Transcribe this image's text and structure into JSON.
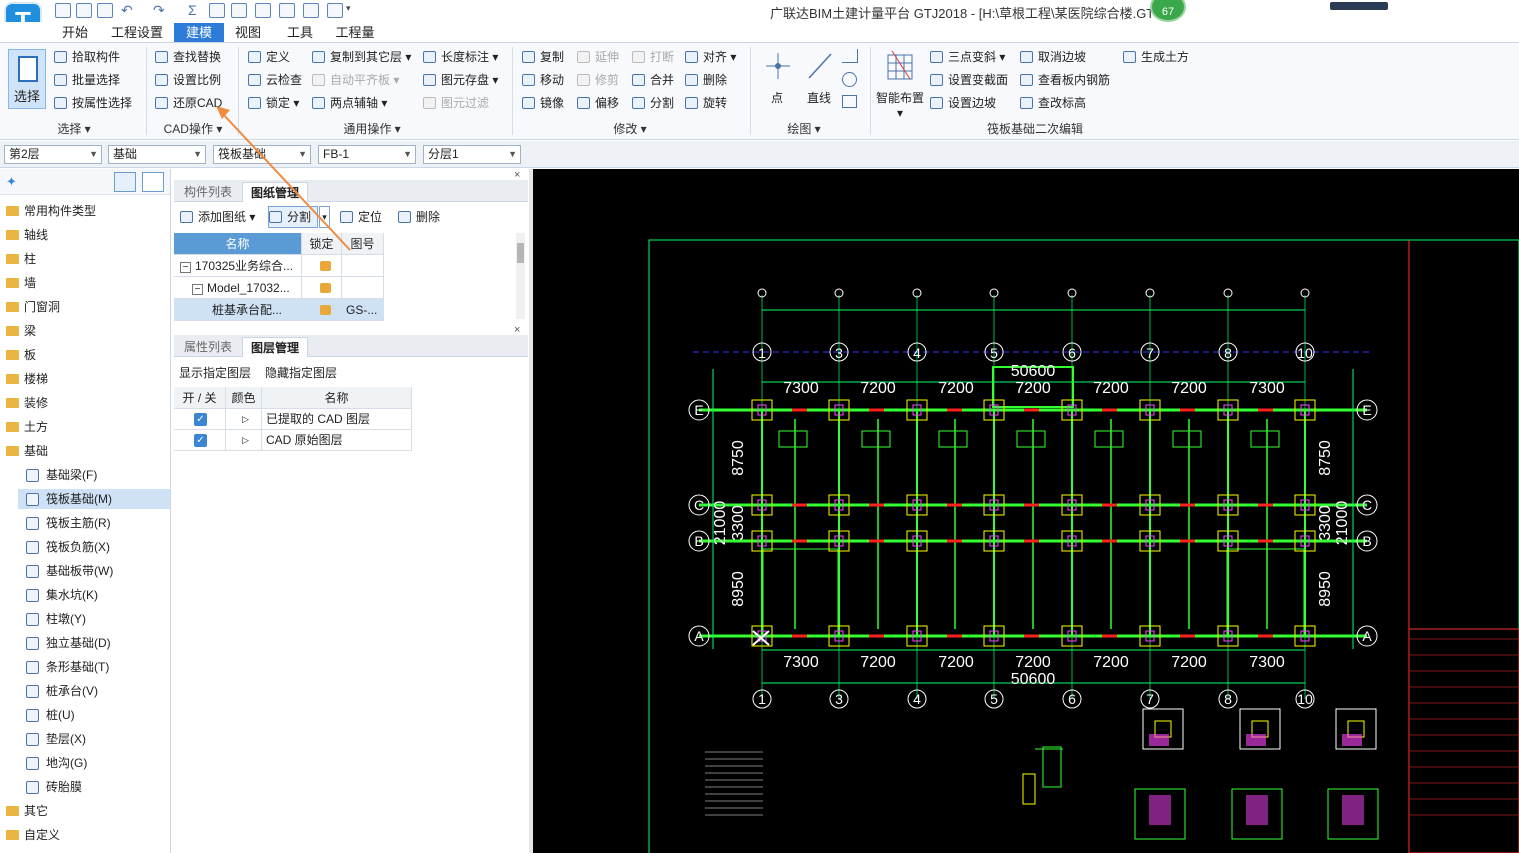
{
  "app": {
    "logo": "T",
    "title": "广联达BIM土建计量平台 GTJ2018 - [H:\\草根工程\\某医院综合楼.GTJ]",
    "badge": "67"
  },
  "quick_access_icons": [
    "save-icon",
    "new-icon",
    "open-icon",
    "undo-icon",
    "redo-icon",
    "sum-icon",
    "table-icon",
    "report-icon",
    "view-icon",
    "arrow-icon",
    "grid-icon",
    "layer-icon",
    "more-icon"
  ],
  "menu": {
    "tabs": [
      "开始",
      "工程设置",
      "建模",
      "视图",
      "工具",
      "工程量"
    ],
    "active": "建模"
  },
  "ribbon": {
    "select": {
      "big": "选择",
      "items": [
        "拾取构件",
        "批量选择",
        "按属性选择"
      ],
      "group": "选择"
    },
    "cad": {
      "items": [
        "查找替换",
        "设置比例",
        "还原CAD"
      ],
      "group": "CAD操作"
    },
    "common": {
      "col1": [
        "定义",
        "云检查",
        "锁定"
      ],
      "col2": [
        "复制到其它层",
        "自动平齐板",
        "两点辅轴"
      ],
      "col3": [
        "长度标注",
        "图元存盘",
        "图元过滤"
      ],
      "group": "通用操作"
    },
    "modify": {
      "col1": [
        "复制",
        "移动",
        "镜像"
      ],
      "col2": [
        "延伸",
        "修剪",
        "偏移"
      ],
      "col3": [
        "打断",
        "合并",
        "分割"
      ],
      "col4": [
        "对齐",
        "删除",
        "旋转"
      ],
      "group": "修改"
    },
    "draw": {
      "items": [
        "点",
        "直线"
      ],
      "group": "绘图"
    },
    "raft": {
      "big": "智能布置",
      "col1": [
        "三点变斜",
        "设置变截面",
        "设置边坡"
      ],
      "col2": [
        "取消边坡",
        "查看板内钢筋",
        "查改标高"
      ],
      "col3": [
        "生成土方"
      ],
      "group": "筏板基础二次编辑"
    }
  },
  "filters": [
    "第2层",
    "基础",
    "筏板基础",
    "FB-1",
    "分层1"
  ],
  "tree": {
    "categories": [
      "常用构件类型",
      "轴线",
      "柱",
      "墙",
      "门窗洞",
      "梁",
      "板",
      "楼梯",
      "装修",
      "土方",
      "基础"
    ],
    "sub_items": [
      "基础梁(F)",
      "筏板基础(M)",
      "筏板主筋(R)",
      "筏板负筋(X)",
      "基础板带(W)",
      "集水坑(K)",
      "柱墩(Y)",
      "独立基础(D)",
      "条形基础(T)",
      "桩承台(V)",
      "桩(U)",
      "垫层(X)",
      "地沟(G)",
      "砖胎膜"
    ],
    "selected": "筏板基础(M)",
    "tail": [
      "其它",
      "自定义"
    ]
  },
  "drawings": {
    "tabs": [
      "构件列表",
      "图纸管理"
    ],
    "toolbar": [
      "添加图纸",
      "分割",
      "定位",
      "删除"
    ],
    "headers": [
      "名称",
      "锁定",
      "图号"
    ],
    "rows": [
      {
        "name": "170325业务综合...",
        "lock": "",
        "code": ""
      },
      {
        "name": "Model_17032...",
        "lock": "",
        "code": ""
      },
      {
        "name": "桩基承台配...",
        "lock": "",
        "code": "GS-..."
      }
    ]
  },
  "layers": {
    "tabs": [
      "属性列表",
      "图层管理"
    ],
    "toolbar": [
      "显示指定图层",
      "隐藏指定图层"
    ],
    "headers": [
      "开 / 关",
      "颜色",
      "名称"
    ],
    "rows": [
      "已提取的 CAD 图层",
      "CAD 原始图层"
    ]
  },
  "cad_drawing": {
    "top_total": "50600",
    "bottom_total": "50600",
    "top_spans": [
      "7300",
      "7200",
      "7200",
      "7200",
      "7200",
      "7200",
      "7300"
    ],
    "bottom_spans": [
      "7300",
      "7200",
      "7200",
      "7200",
      "7200",
      "7200",
      "7300"
    ],
    "axis_numbers": [
      "1",
      "3",
      "4",
      "5",
      "6",
      "7",
      "8",
      "10"
    ],
    "row_axes": [
      "E",
      "C",
      "B",
      "A"
    ],
    "left_dims": [
      "8750",
      "21000",
      "3300",
      "8950"
    ],
    "right_dims": [
      "8750",
      "3300",
      "21000",
      "8950"
    ],
    "colors": {
      "bg": "#000000",
      "frame": "#00ff66",
      "beam": "#33ff33",
      "axis": "#ffffff",
      "dim": "#ffffff",
      "grid": "#3333ff",
      "accent": "#ff2020",
      "column": "#ff44ff",
      "highlight": "#ffff00"
    }
  },
  "annotation": {
    "arrow_color": "#f08a3c"
  }
}
